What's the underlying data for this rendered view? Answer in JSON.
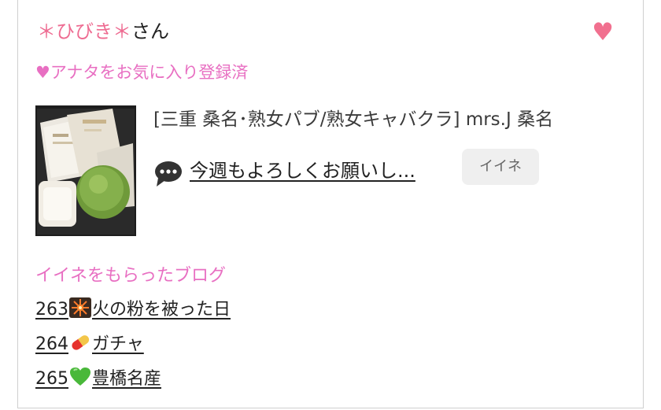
{
  "profile": {
    "name": "＊ひびき＊",
    "name_suffix": "さん",
    "favorite_status": "♥アナタをお気に入り登録済"
  },
  "shop": {
    "line": "[三重 桑名･熟女パブ/熟女キャバクラ]  mrs.J 桑名"
  },
  "message": {
    "preview": "今週もよろしくお願いし..."
  },
  "iine": {
    "label": "イイネ"
  },
  "blogs": {
    "heading": "イイネをもらったブログ",
    "items": [
      {
        "number": "263",
        "icon": "firework-icon",
        "title": "火の粉を被った日"
      },
      {
        "number": "264",
        "icon": "pill-icon",
        "title": "ガチャ"
      },
      {
        "number": "265",
        "icon": "green-heart-icon",
        "title": "豊橋名産"
      }
    ]
  },
  "colors": {
    "pink_accent": "#ee6c92",
    "magenta_text": "#e86fc2",
    "heart": "#f1708f",
    "button_bg": "#efefef"
  }
}
